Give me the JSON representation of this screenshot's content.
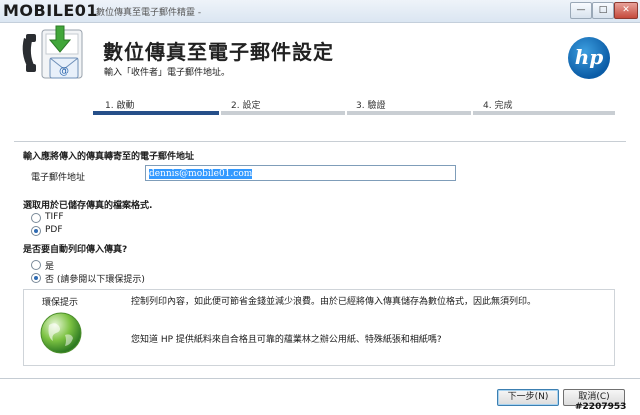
{
  "window": {
    "title": "數位傳真至電子郵件精靈 -",
    "watermark": "MOBILE01",
    "minimize": "—",
    "maximize": "□",
    "close": "✕"
  },
  "header": {
    "title": "數位傳真至電子郵件設定",
    "subtitle": "輸入「收件者」電子郵件地址。",
    "logo_text": "hp",
    "icon": "fax-to-email-icon"
  },
  "steps": [
    {
      "label": "1. 啟動",
      "active": true
    },
    {
      "label": "2. 設定",
      "active": false
    },
    {
      "label": "3. 驗證",
      "active": false
    },
    {
      "label": "4. 完成",
      "active": false
    }
  ],
  "form": {
    "email_section_title": "輸入應將傳入的傳真轉寄至的電子郵件地址",
    "email_label": "電子郵件地址",
    "email_value": "dennis@mobile01.com",
    "format_title": "選取用於已儲存傳真的檔案格式.",
    "format_options": [
      {
        "label": "TIFF",
        "selected": false
      },
      {
        "label": "PDF",
        "selected": true
      }
    ],
    "print_title": "是否要自動列印傳入傳真?",
    "print_options": [
      {
        "label": "是",
        "selected": false
      },
      {
        "label": "否 (請參閱以下環保提示)",
        "selected": true
      }
    ]
  },
  "eco_tip": {
    "title": "環保提示",
    "text1": "控制列印內容，如此便可節省金錢並減少浪費。由於已經將傳入傳真儲存為數位格式，因此無須列印。",
    "text2": "您知道 HP 提供紙料來自合格且可靠的蘊業林之辦公用紙、特殊紙張和相紙嗎?",
    "icon": "globe-icon"
  },
  "buttons": {
    "next": "下一步(N)",
    "cancel": "取消(C)"
  },
  "post_id": "#2207953",
  "colors": {
    "step_active": "#264f89",
    "step_inactive": "#c9ced3",
    "selection": "#3399ff"
  }
}
